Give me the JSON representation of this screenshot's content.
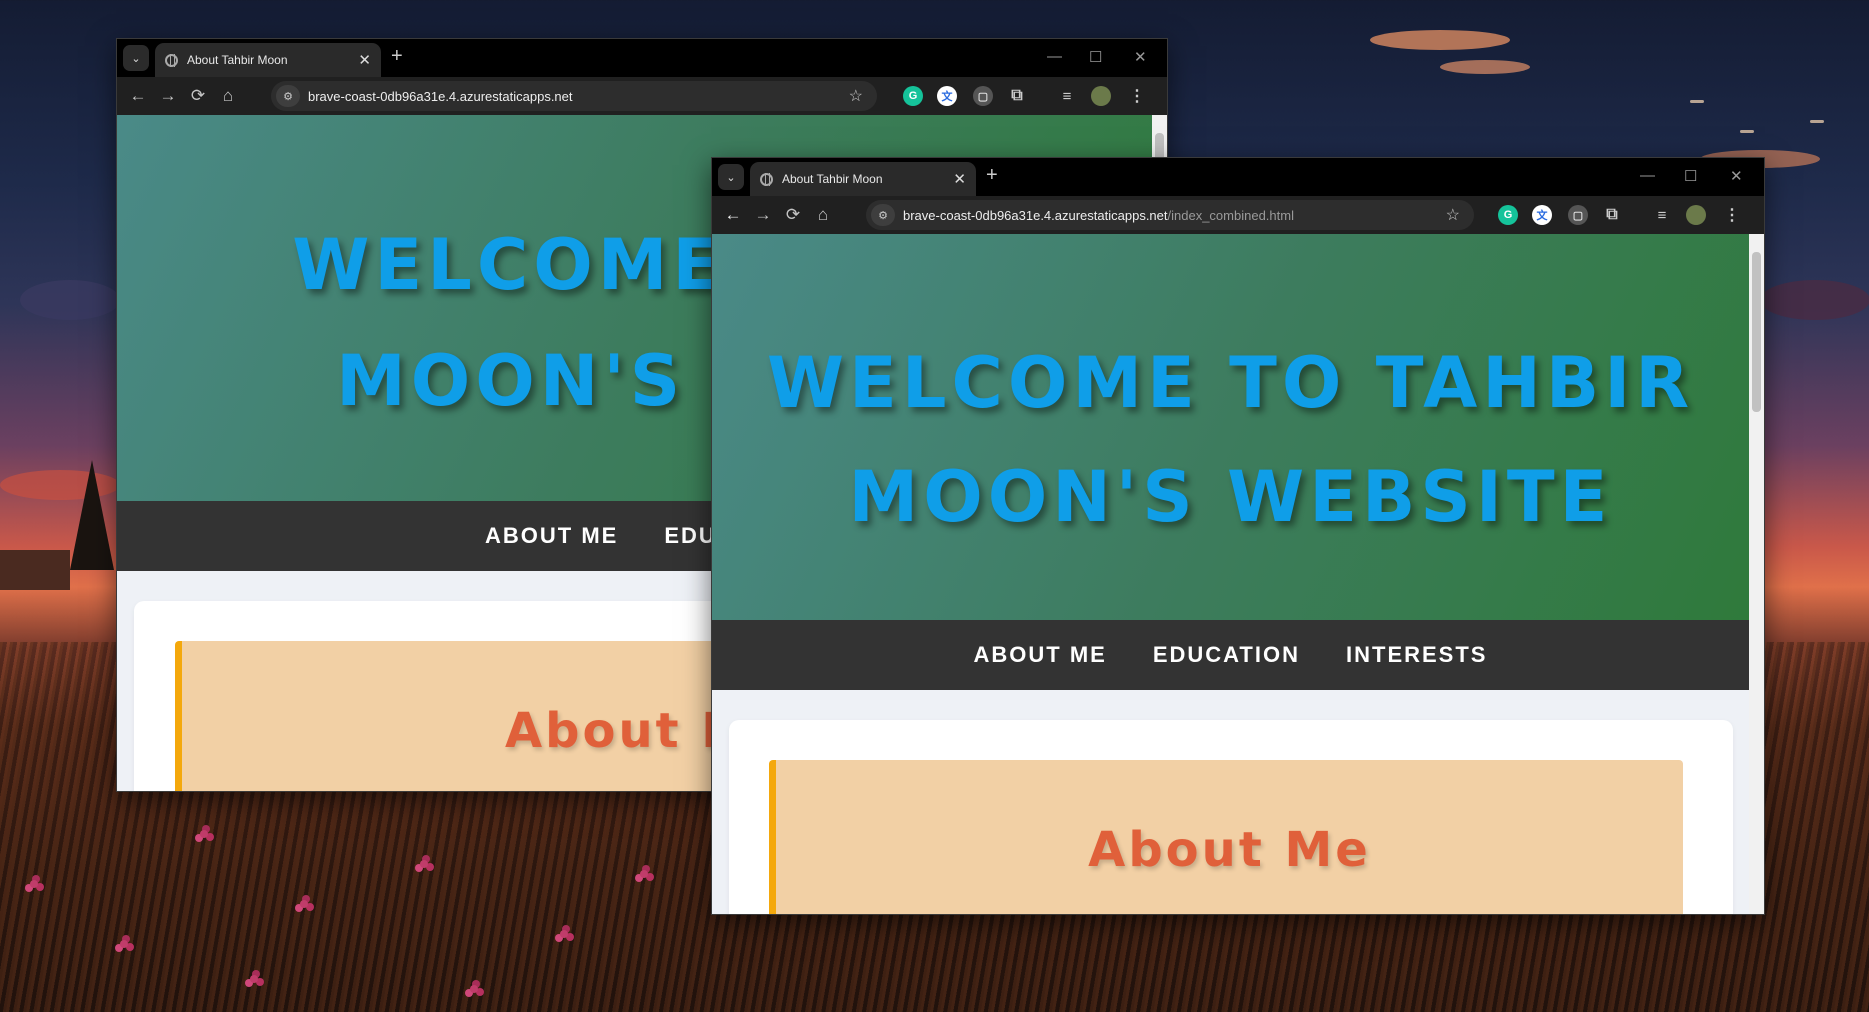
{
  "desktop": {
    "wallpaper": "sunset-field"
  },
  "back_window": {
    "tab_title": "About Tahbir Moon",
    "url_host": "brave-coast-0db96a31e.4.azurestaticapps.net",
    "url_path": "",
    "hero_line1": "WELCOME TO",
    "hero_line2": "MOON'S WI",
    "nav": [
      "ABOUT ME",
      "EDUCATION"
    ],
    "about_heading": "About M"
  },
  "front_window": {
    "tab_title": "About Tahbir Moon",
    "url_host": "brave-coast-0db96a31e.4.azurestaticapps.net",
    "url_path": "/index_combined.html",
    "hero_line1": "WELCOME TO TAHBIR",
    "hero_line2": "MOON'S WEBSITE",
    "nav": [
      "ABOUT ME",
      "EDUCATION",
      "INTERESTS"
    ],
    "about_heading": "About Me"
  },
  "icons": {
    "back": "←",
    "forward": "→",
    "reload": "⟳",
    "home": "⌂",
    "star": "☆",
    "close_tab": "✕",
    "new_tab": "+",
    "minimize": "—",
    "maximize": "☐",
    "close": "✕",
    "menu": "⋮",
    "tab_dropdown": "⌄",
    "puzzle": "⧉",
    "media": "≡"
  },
  "colors": {
    "hero_text": "#0f9ee8",
    "nav_bg": "#333333",
    "about_bg": "#f2d0a5",
    "about_border": "#f4a80c",
    "about_text": "#e0603a"
  }
}
